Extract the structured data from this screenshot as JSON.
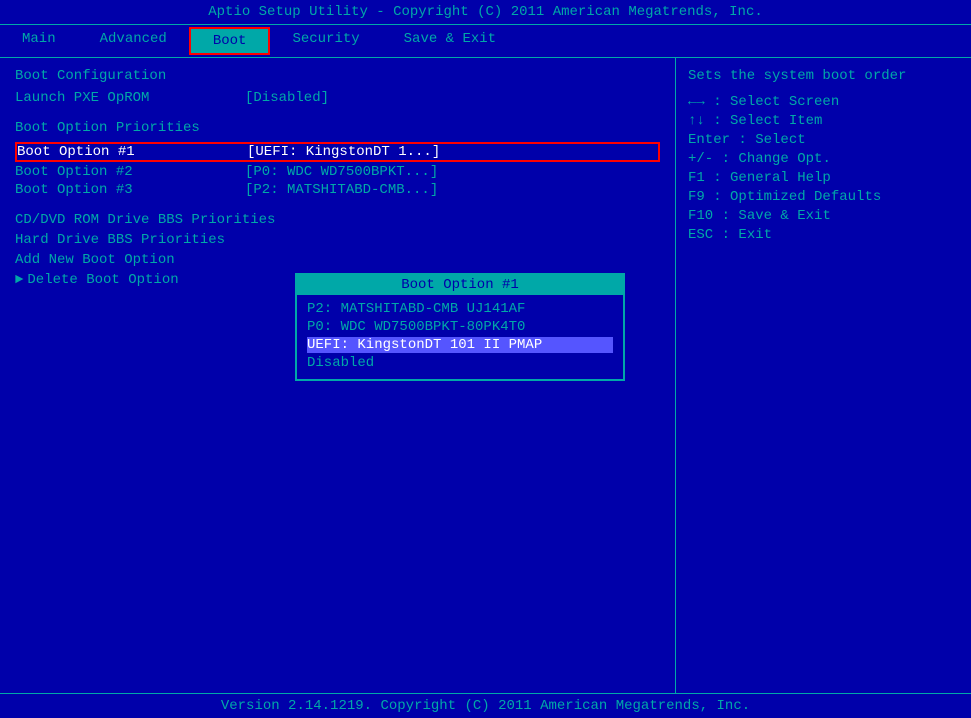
{
  "title": "Aptio Setup Utility - Copyright (C) 2011 American Megatrends, Inc.",
  "footer": "Version 2.14.1219. Copyright (C) 2011 American Megatrends, Inc.",
  "menu": {
    "items": [
      {
        "id": "main",
        "label": "Main",
        "active": false
      },
      {
        "id": "advanced",
        "label": "Advanced",
        "active": false
      },
      {
        "id": "boot",
        "label": "Boot",
        "active": true
      },
      {
        "id": "security",
        "label": "Security",
        "active": false
      },
      {
        "id": "save-exit",
        "label": "Save & Exit",
        "active": false
      }
    ]
  },
  "left": {
    "section_boot_config": "Boot Configuration",
    "launch_pxe_label": "Launch PXE OpROM",
    "launch_pxe_value": "[Disabled]",
    "section_boot_priorities": "Boot Option Priorities",
    "boot_option_1_label": "Boot Option #1",
    "boot_option_1_value": "[UEFI: KingstonDT 1...]",
    "boot_option_2_label": "Boot Option #2",
    "boot_option_2_value": "[P0: WDC WD7500BPKT...]",
    "boot_option_3_label": "Boot Option #3",
    "boot_option_3_value": "[P2: MATSHITABD-CMB...]",
    "section_cd_dvd": "CD/DVD ROM Drive BBS Priorities",
    "section_hdd": "Hard Drive BBS Priorities",
    "add_new_boot": "Add New Boot Option",
    "delete_boot": "Delete Boot Option"
  },
  "dropdown": {
    "title": "Boot Option #1",
    "options": [
      {
        "id": "opt1",
        "label": "P2: MATSHITABD-CMB UJ141AF",
        "selected": false
      },
      {
        "id": "opt2",
        "label": "P0: WDC WD7500BPKT-80PK4T0",
        "selected": false
      },
      {
        "id": "opt3",
        "label": "UEFI: KingstonDT 101 II PMAP",
        "selected": true
      },
      {
        "id": "opt4",
        "label": "Disabled",
        "selected": false
      }
    ]
  },
  "right": {
    "help_text": "Sets the system boot order",
    "keys": [
      {
        "key": "←→",
        "desc": ": Select Screen"
      },
      {
        "key": "↑↓",
        "desc": ": Select Item"
      },
      {
        "key": "Enter",
        "desc": ": Select"
      },
      {
        "key": "+/-",
        "desc": ": Change Opt."
      },
      {
        "key": "F1",
        "desc": ": General Help"
      },
      {
        "key": "F9",
        "desc": ": Optimized Defaults"
      },
      {
        "key": "F10",
        "desc": ": Save & Exit"
      },
      {
        "key": "ESC",
        "desc": ": Exit"
      }
    ]
  }
}
